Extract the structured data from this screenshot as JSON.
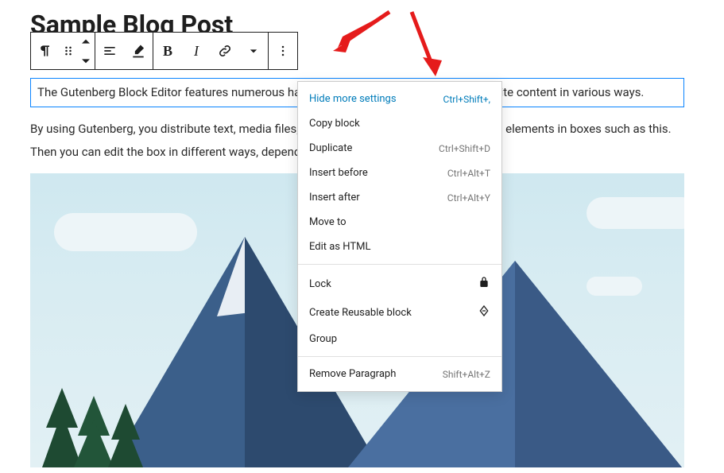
{
  "title": "Sample Blog Post",
  "paragraph1": "The Gutenberg Block Editor features numerous handy tools that enable you to edit website content in various ways.",
  "paragraph2": "By using Gutenberg, you distribute text, media files, shortcodes, buttons and other various elements in boxes such as this. Then you can edit the box in different ways, depending on the goal you're chasing.",
  "toolbar": {
    "block_type_label": "Paragraph",
    "drag_label": "Drag",
    "moveup_label": "Move up",
    "movedown_label": "Move down",
    "align_label": "Align",
    "transform_label": "Transform",
    "bold_label": "B",
    "italic_label": "I",
    "link_label": "Link",
    "more_rich_label": "More rich text",
    "options_label": "Options"
  },
  "menu": {
    "section1": [
      {
        "label": "Hide more settings",
        "shortcut": "Ctrl+Shift+,",
        "active": true
      },
      {
        "label": "Copy block",
        "shortcut": ""
      },
      {
        "label": "Duplicate",
        "shortcut": "Ctrl+Shift+D"
      },
      {
        "label": "Insert before",
        "shortcut": "Ctrl+Alt+T"
      },
      {
        "label": "Insert after",
        "shortcut": "Ctrl+Alt+Y"
      },
      {
        "label": "Move to",
        "shortcut": ""
      },
      {
        "label": "Edit as HTML",
        "shortcut": ""
      }
    ],
    "section2": [
      {
        "label": "Lock",
        "icon": "lock"
      },
      {
        "label": "Create Reusable block",
        "icon": "diamond"
      },
      {
        "label": "Group",
        "icon": ""
      }
    ],
    "section3": [
      {
        "label": "Remove Paragraph",
        "shortcut": "Shift+Alt+Z"
      }
    ]
  }
}
